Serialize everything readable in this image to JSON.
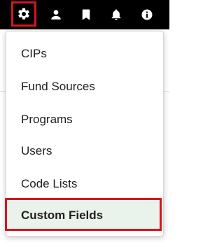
{
  "header": {
    "icons": [
      {
        "name": "gear-icon"
      },
      {
        "name": "user-icon"
      },
      {
        "name": "bookmark-icon"
      },
      {
        "name": "bell-icon"
      },
      {
        "name": "info-icon"
      }
    ]
  },
  "menu": {
    "items": [
      {
        "label": "CIPs"
      },
      {
        "label": "Fund Sources"
      },
      {
        "label": "Programs"
      },
      {
        "label": "Users"
      },
      {
        "label": "Code Lists"
      },
      {
        "label": "Custom Fields",
        "active": true
      }
    ]
  },
  "colors": {
    "topbar_background": "#000000",
    "highlight_red": "#d6161b",
    "active_item_background": "#eaf2ec",
    "menu_text": "#212121"
  }
}
